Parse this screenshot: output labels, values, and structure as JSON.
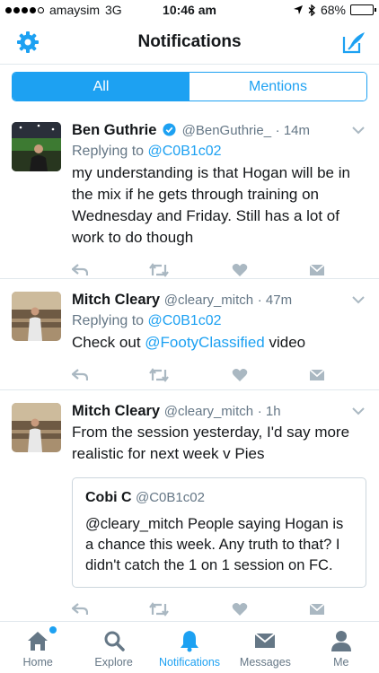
{
  "status_bar": {
    "carrier": "amaysim",
    "network": "3G",
    "time": "10:46 am",
    "battery": "68%",
    "battery_level": 0.68
  },
  "nav": {
    "title": "Notifications",
    "left_icon": "gear-icon",
    "right_icon": "compose-tweet-icon"
  },
  "segment": {
    "all": "All",
    "mentions": "Mentions",
    "selected": "All"
  },
  "tweets": [
    {
      "name": "Ben Guthrie",
      "verified": true,
      "handle": "@BenGuthrie_",
      "time": "· 14m",
      "reply_prefix": "Replying to ",
      "reply_handle": "@C0B1c02",
      "text": "my understanding is that Hogan will be in the mix if he gets through training on Wednesday and Friday. Still has a lot of work to do though"
    },
    {
      "name": "Mitch Cleary",
      "handle": "@cleary_mitch",
      "time": "· 47m",
      "reply_prefix": "Replying to ",
      "reply_handle": "@C0B1c02",
      "text_pre": "Check out ",
      "text_link": "@FootyClassified",
      "text_post": " video"
    },
    {
      "name": "Mitch Cleary",
      "handle": "@cleary_mitch",
      "time": "· 1h",
      "text": "From the session yesterday, I'd say more realistic for next week v Pies",
      "quote": {
        "name": "Cobi C",
        "handle": "@C0B1c02",
        "text": "@cleary_mitch People saying Hogan is a chance this week. Any truth to that? I didn't catch the 1 on 1 session on FC."
      }
    }
  ],
  "tabs": [
    {
      "label": "Home",
      "icon": "home-icon"
    },
    {
      "label": "Explore",
      "icon": "search-icon"
    },
    {
      "label": "Notifications",
      "icon": "bell-icon"
    },
    {
      "label": "Messages",
      "icon": "envelope-icon"
    },
    {
      "label": "Me",
      "icon": "person-icon"
    }
  ],
  "colors": {
    "accent": "#1da1f2",
    "secondary_text": "#657786",
    "border": "#e1e8ed"
  }
}
